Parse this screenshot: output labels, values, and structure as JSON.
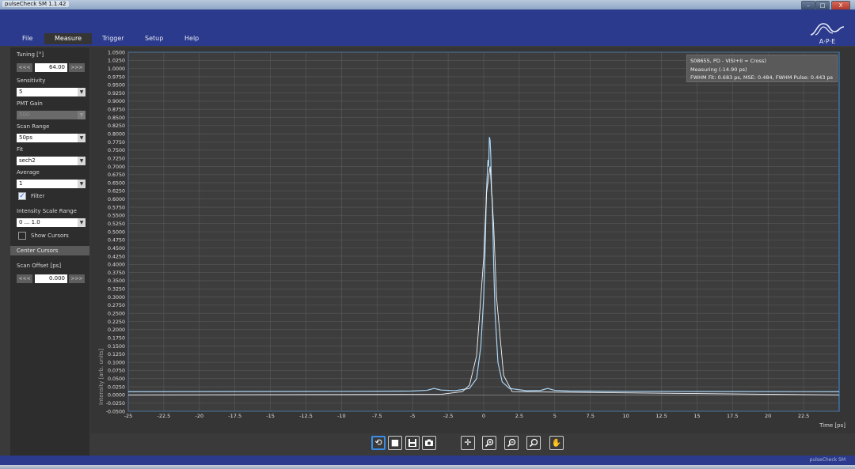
{
  "window": {
    "title": "pulseCheck SM 1.1.42",
    "controls": [
      "–",
      "□",
      "X"
    ]
  },
  "menu": [
    "File",
    "Measure",
    "Trigger",
    "Setup",
    "Help"
  ],
  "menu_active": "Measure",
  "logo_text": "A·P·E",
  "sidebar": {
    "tuning_label": "Tuning [°]",
    "tuning_dec": "<<<",
    "tuning_value": "64.00",
    "tuning_inc": ">>>",
    "sensitivity_label": "Sensitivity",
    "sensitivity_value": "5",
    "pmt_gain_label": "PMT Gain",
    "pmt_gain_value": "500",
    "scan_range_label": "Scan Range",
    "scan_range_value": "50ps",
    "fit_label": "Fit",
    "fit_value": "sech2",
    "average_label": "Average",
    "average_value": "1",
    "filter_label": "Filter",
    "filter_checked": true,
    "intensity_scale_label": "Intensity Scale Range",
    "intensity_scale_value": "0 ... 1.0",
    "show_cursors_label": "Show Cursors",
    "show_cursors_checked": false,
    "center_cursors_label": "Center Cursors",
    "scan_offset_label": "Scan Offset [ps]",
    "scan_offset_dec": "<<<",
    "scan_offset_value": "0.000",
    "scan_offset_inc": ">>>"
  },
  "legend": {
    "line1": "S08655, PD - VISI+II = Cross)",
    "line2": "Measuring (-14.90 ps)",
    "line3": "FWHM Fit: 0.683 ps, MSE: 0.484, FWHM Pulse: 0.443 ps"
  },
  "toolbar": {
    "buttons": [
      "restart-icon",
      "stop-icon",
      "save-icon",
      "camera-icon",
      "crosshair-icon",
      "zoom-in-icon",
      "zoom-out-icon",
      "zoom-reset-icon",
      "pan-hand-icon"
    ]
  },
  "status_text": "pulseCheck SM",
  "colors": {
    "accent": "#2b3a8c",
    "trace": "#a9d4f5",
    "plot_bg": "#3d3d3d",
    "selected": "#3a8ee6"
  },
  "chart_data": {
    "type": "line",
    "xlabel": "Time [ps]",
    "ylabel": "Intensity [arb. units]",
    "xlim": [
      -25,
      25
    ],
    "ylim": [
      -0.05,
      1.05
    ],
    "x_ticks": [
      -25,
      -22.5,
      -20,
      -17.5,
      -15,
      -12.5,
      -10,
      -7.5,
      -5,
      -2.5,
      0,
      2.5,
      5,
      7.5,
      10,
      12.5,
      15,
      17.5,
      20,
      22.5
    ],
    "x_tick_labels": [
      "-25",
      "-22.5",
      "-20",
      "-17.5",
      "-15",
      "-12.5",
      "-10",
      "-7.5",
      "-5",
      "-2.5",
      "0",
      "2.5",
      "5",
      "7.5",
      "10",
      "12.5",
      "15",
      "17.5",
      "20",
      "22.5"
    ],
    "y_tick_labels": [
      "1.0500",
      "1.0250",
      "1.0000",
      "0.9750",
      "0.9500",
      "0.9250",
      "0.9000",
      "0.8750",
      "0.8500",
      "0.8250",
      "0.8000",
      "0.7750",
      "0.7500",
      "0.7250",
      "0.7000",
      "0.6750",
      "0.6500",
      "0.6250",
      "0.6000",
      "0.5750",
      "0.5500",
      "0.5250",
      "0.5000",
      "0.4750",
      "0.4500",
      "0.4250",
      "0.4000",
      "0.3750",
      "0.3500",
      "0.3250",
      "0.3000",
      "0.2750",
      "0.2500",
      "0.2250",
      "0.2000",
      "0.1750",
      "0.1500",
      "0.1250",
      "0.1000",
      "0.0750",
      "0.0500",
      "0.0250",
      "0.0000",
      "-0.0250",
      "-0.0500"
    ],
    "grid": true,
    "series": [
      {
        "x": [
          -25,
          -10,
          -5,
          -4,
          -3.5,
          -3,
          -2,
          -1,
          -0.5,
          -0.2,
          0,
          0.1,
          0.2,
          0.3,
          0.35,
          0.4,
          0.45,
          0.5,
          0.55,
          0.6,
          0.7,
          0.8,
          1.0,
          1.3,
          1.8,
          3,
          4,
          4.5,
          5,
          6,
          10,
          25
        ],
        "y": [
          0.01,
          0.011,
          0.012,
          0.014,
          0.02,
          0.015,
          0.013,
          0.02,
          0.05,
          0.15,
          0.3,
          0.45,
          0.63,
          0.72,
          0.7,
          0.79,
          0.78,
          0.73,
          0.62,
          0.6,
          0.4,
          0.25,
          0.1,
          0.04,
          0.02,
          0.013,
          0.014,
          0.02,
          0.014,
          0.012,
          0.011,
          0.01
        ]
      },
      {
        "x": [
          -25,
          -3,
          -1.5,
          -1,
          -0.5,
          0,
          0.2,
          0.45,
          0.7,
          0.9,
          1.4,
          2,
          25
        ],
        "y": [
          0.0,
          0.002,
          0.01,
          0.03,
          0.12,
          0.42,
          0.62,
          0.7,
          0.52,
          0.3,
          0.06,
          0.01,
          0.0
        ]
      }
    ]
  }
}
